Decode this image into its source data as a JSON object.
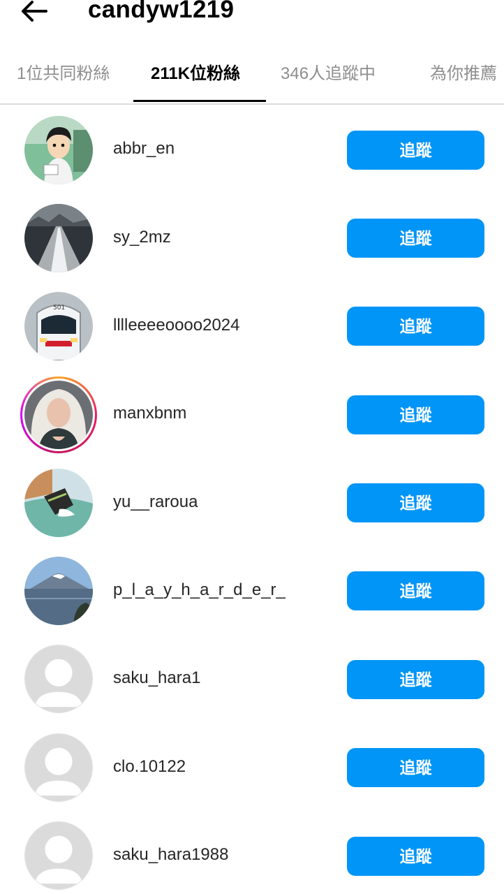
{
  "header": {
    "title": "candyw1219",
    "back_icon": "arrow-left-icon"
  },
  "tabs": [
    {
      "label": "1位共同粉絲",
      "active": false
    },
    {
      "label": "211K位粉絲",
      "active": true
    },
    {
      "label": "346人追蹤中",
      "active": false
    },
    {
      "label": "為你推薦",
      "active": false
    }
  ],
  "followers": [
    {
      "username": "abbr_en",
      "button": "追蹤",
      "avatar": "cartoon-boy"
    },
    {
      "username": "sy_2mz",
      "button": "追蹤",
      "avatar": "ocean-wake"
    },
    {
      "username": "lllleeeeoooo2024",
      "button": "追蹤",
      "avatar": "train"
    },
    {
      "username": "manxbnm",
      "button": "追蹤",
      "avatar": "woman-story-ring"
    },
    {
      "username": "yu__raroua",
      "button": "追蹤",
      "avatar": "cat-drawing"
    },
    {
      "username": "p_l_a_y_h_a_r_d_e_r_",
      "button": "追蹤",
      "avatar": "mountain-lake"
    },
    {
      "username": "saku_hara1",
      "button": "追蹤",
      "avatar": "default"
    },
    {
      "username": "clo.10122",
      "button": "追蹤",
      "avatar": "default"
    },
    {
      "username": "saku_hara1988",
      "button": "追蹤",
      "avatar": "default"
    }
  ],
  "colors": {
    "follow_button": "#0095f6",
    "active_tab": "#000000",
    "inactive_tab": "#8e8e8e"
  }
}
